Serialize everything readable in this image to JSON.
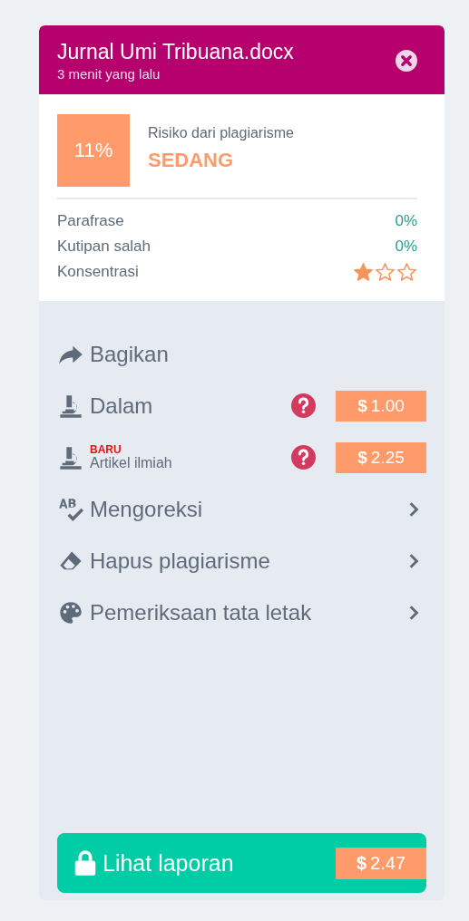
{
  "header": {
    "title": "Jurnal Umi Tribuana.docx",
    "subtitle": "3 menit yang lalu"
  },
  "risk": {
    "score": "11%",
    "label": "Risiko dari plagiarisme",
    "level_text": "SEDANG"
  },
  "metrics": [
    {
      "kind": "text",
      "label": "Parafrase",
      "value": "0%"
    },
    {
      "kind": "text",
      "label": "Kutipan salah",
      "value": "0%"
    },
    {
      "kind": "stars",
      "label": "Konsentrasi",
      "stars": 1
    }
  ],
  "menu": [
    {
      "kind": "link",
      "label": "Bagikan"
    },
    {
      "kind": "paid",
      "label": "Dalam",
      "price": "**$** 1.00"
    },
    {
      "kind": "paid",
      "label": "Artikel ilmiah",
      "badge": "BARU",
      "price": "**$** 2.25"
    },
    {
      "kind": "submenu",
      "label": "Mengoreksi"
    },
    {
      "kind": "submenu",
      "label": "Hapus plagiarisme"
    },
    {
      "kind": "submenu",
      "label": "Pemeriksaan tata letak"
    }
  ],
  "report_button": {
    "label": "Lihat laporan",
    "price": "**$** 2.47"
  }
}
